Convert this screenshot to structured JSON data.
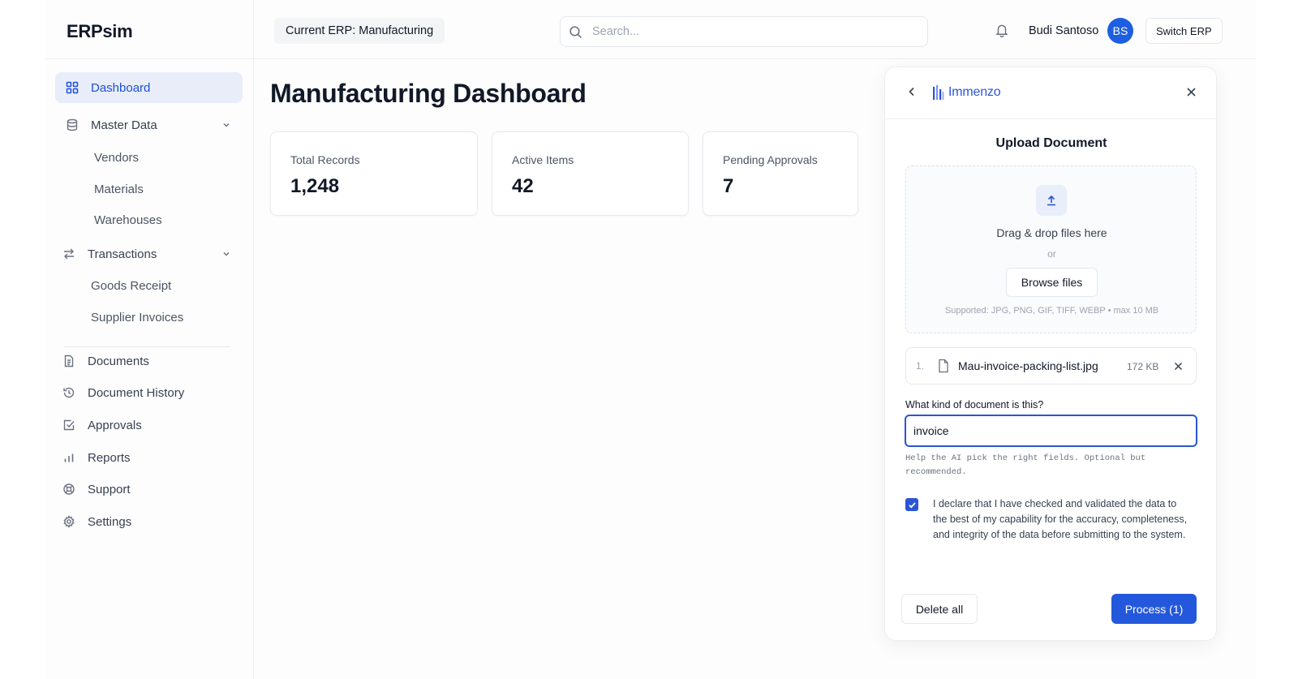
{
  "app": {
    "brand": "ERPsim"
  },
  "header": {
    "erp_label": "Current ERP: Manufacturing",
    "search_placeholder": "Search...",
    "user_name": "Budi Santoso",
    "user_initials": "BS",
    "switch_label": "Switch ERP",
    "avatar_color": "#1d5fe0"
  },
  "sidebar": {
    "items": [
      {
        "label": "Dashboard",
        "icon": "grid-icon",
        "active": true
      },
      {
        "label": "Master Data",
        "icon": "database-icon",
        "expanded": true,
        "children": [
          "Vendors",
          "Materials",
          "Warehouses"
        ]
      },
      {
        "label": "Transactions",
        "icon": "arrows-swap-icon",
        "expanded": true,
        "children": [
          "Goods Receipt",
          "Supplier Invoices"
        ]
      },
      {
        "label": "Documents",
        "icon": "document-icon"
      },
      {
        "label": "Document History",
        "icon": "history-icon"
      },
      {
        "label": "Approvals",
        "icon": "checkbox-icon"
      },
      {
        "label": "Reports",
        "icon": "bar-chart-icon"
      },
      {
        "label": "Support",
        "icon": "lifebuoy-icon"
      },
      {
        "label": "Settings",
        "icon": "gear-icon"
      }
    ]
  },
  "main": {
    "title": "Manufacturing Dashboard",
    "stats": [
      {
        "label": "Total Records",
        "value": "1,248"
      },
      {
        "label": "Active Items",
        "value": "42"
      },
      {
        "label": "Pending Approvals",
        "value": "7"
      }
    ]
  },
  "upload_panel": {
    "logo_text": "Immenzo",
    "title": "Upload Document",
    "dropzone_text": "Drag & drop files here",
    "or_text": "or",
    "browse_label": "Browse files",
    "supported_text": "Supported: JPG, PNG, GIF, TIFF, WEBP • max 10 MB",
    "files": [
      {
        "index": "1.",
        "name": "Mau-invoice-packing-list.jpg",
        "size": "172 KB"
      }
    ],
    "question_label": "What kind of document is this?",
    "doc_type_value": "invoice",
    "help_text": "Help the AI pick the right fields. Optional but recommended.",
    "declaration_checked": true,
    "declaration_text": "I declare that I have checked and validated the data to the best of my capability for the accuracy, completeness, and integrity of the data before submitting to the system.",
    "delete_label": "Delete all",
    "process_label": "Process (1)",
    "accent_color": "#2458dc"
  }
}
